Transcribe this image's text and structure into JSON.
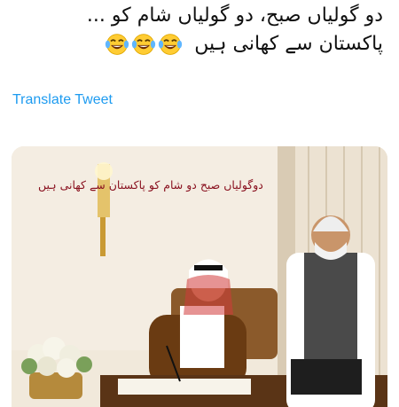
{
  "tweet": {
    "text_line_1": "دو گولیاں صبح، دو گولیاں شام کو ...",
    "text_line_2": "پاکستان سے کھانی ہیں",
    "emojis": [
      "face-with-tears-of-joy-icon",
      "face-with-tears-of-joy-icon",
      "face-with-tears-of-joy-icon"
    ],
    "translate_label": "Translate Tweet"
  },
  "media": {
    "overlay_caption": "دوگولیاں صبح دو شام کو پاکستان سے کھانی ہیں"
  },
  "colors": {
    "link": "#1d9bf0",
    "caption": "#8a1220",
    "text": "#111111"
  }
}
